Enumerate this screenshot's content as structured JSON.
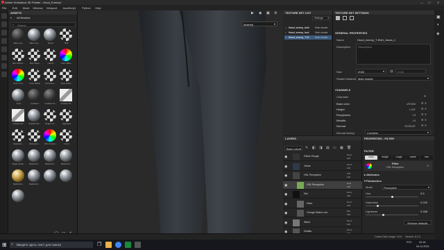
{
  "window": {
    "title": "Adobe Substance 3D Painter - Hood_Enemy1"
  },
  "menu": [
    "File",
    "Edit",
    "Mode",
    "Window",
    "Viewport",
    "JavaScript",
    "Python",
    "Help"
  ],
  "assets": {
    "header": "ASSETS",
    "all_libraries": "All libraries",
    "search_placeholder": "Search",
    "items": [
      {
        "label": "Basic Lig...",
        "style": "dark"
      },
      {
        "label": "Basic Lig...",
        "style": "metal"
      },
      {
        "label": "Bevel",
        "style": "metal"
      },
      {
        "label": "Blur",
        "style": "checker"
      },
      {
        "label": "Blur Directi...",
        "style": "checker"
      },
      {
        "label": "Blur Slope",
        "style": "checker"
      },
      {
        "label": "Clamp",
        "style": "checker"
      },
      {
        "label": "Color Bala...",
        "style": "color"
      },
      {
        "label": "Color Corr...",
        "style": "color"
      },
      {
        "label": "Color Match",
        "style": "checker"
      },
      {
        "label": "Contrast L...",
        "style": "checker"
      },
      {
        "label": "Drop Shad...",
        "style": "checker"
      },
      {
        "label": "Emit",
        "style": "metal"
      },
      {
        "label": "Gradient",
        "style": "dark"
      },
      {
        "label": "Gradient D...",
        "style": "dark"
      },
      {
        "label": "Gradient M...",
        "style": "sheet"
      },
      {
        "label": "Gradient M...",
        "style": "sheet"
      },
      {
        "label": "Gradient M...",
        "style": "metal"
      },
      {
        "label": "Height To ...",
        "style": "checker"
      },
      {
        "label": "Highpass",
        "style": "checker"
      },
      {
        "label": "Highpass ...",
        "style": "checker"
      },
      {
        "label": "Histogram...",
        "style": "checker"
      },
      {
        "label": "HSL Percep...",
        "style": "color"
      },
      {
        "label": "Invert",
        "style": "checker"
      },
      {
        "label": "Magic Scale...",
        "style": "metal"
      },
      {
        "label": "MatFinish ...",
        "style": "metal"
      },
      {
        "label": "MatFinish ...",
        "style": "metal"
      },
      {
        "label": "MatFinish ...",
        "style": "metal"
      },
      {
        "label": "MatFinish ...",
        "style": "gold"
      },
      {
        "label": "MatFinish ...",
        "style": "metal"
      },
      {
        "label": "",
        "style": "metal"
      },
      {
        "label": "",
        "style": "metal"
      },
      {
        "label": "",
        "style": "metal"
      }
    ]
  },
  "viewport": {
    "material_mode": "Material"
  },
  "texture_set_list": {
    "header": "TEXTURE SET LIST",
    "settings_label": "Settings",
    "rows": [
      {
        "name": "Hood_enemy_bott",
        "shader": "Main shader",
        "selected": false
      },
      {
        "name": "Hood_enemy_bod",
        "shader": "Main shader",
        "selected": false
      },
      {
        "name": "Hood_enemy_T-Sl",
        "shader": "Main shader",
        "selected": true
      }
    ]
  },
  "texture_set_settings": {
    "header": "TEXTURE SET SETTINGS",
    "general_header": "GENERAL PROPERTIES",
    "name_label": "Name",
    "name_value": "Hood_enemy_T-Shirt_Jeans_1",
    "description_label": "Description",
    "description_placeholder": "Description",
    "size_label": "Size",
    "size_value": "2048",
    "size_linked": "2048",
    "shader_label": "Shader instance",
    "shader_value": "Main shader",
    "channels_header": "CHANNELS",
    "channels_label": "Channels",
    "channels": [
      {
        "name": "Base color",
        "format": "sRGB8"
      },
      {
        "name": "Height",
        "format": "L16F"
      },
      {
        "name": "Roughness",
        "format": "L8"
      },
      {
        "name": "Metallic",
        "format": "L8"
      },
      {
        "name": "Normal",
        "format": "RGB16F"
      }
    ],
    "normal_mixing_label": "Normal mixing",
    "normal_mixing_value": "Combine"
  },
  "layers": {
    "header": "LAYERS",
    "blend_select": "Base color",
    "items": [
      {
        "name": "Fabric Rough",
        "blend": "Norm",
        "opacity": "100",
        "thumb": "#333",
        "indent": false,
        "selected": false
      },
      {
        "name": "Jeans",
        "blend": "Norm",
        "opacity": "100",
        "thumb": "#2d3a4a",
        "indent": false,
        "selected": false
      },
      {
        "name": "HSL Perceptive",
        "blend": "Pthr",
        "opacity": "100",
        "thumb": "#444",
        "indent": false,
        "selected": false
      },
      {
        "name": "HSL Perceptive",
        "blend": "Repl",
        "opacity": "100",
        "thumb": "#7a5",
        "indent": true,
        "selected": true
      },
      {
        "name": "Dirt",
        "blend": "Norm",
        "opacity": "100",
        "thumb": "#111",
        "indent": false,
        "selected": false
      },
      {
        "name": "Paint",
        "blend": "Norm",
        "opacity": "100",
        "thumb": "#666",
        "indent": true,
        "selected": false
      },
      {
        "name": "Grunge Stains Lea",
        "blend": "Mul",
        "opacity": "100",
        "thumb": "#555",
        "indent": true,
        "selected": false
      },
      {
        "name": "Stitch",
        "blend": "Norm",
        "opacity": "100",
        "thumb": "#777",
        "indent": false,
        "selected": false
      },
      {
        "name": "Details",
        "blend": "Norm",
        "opacity": "100",
        "thumb": "#555",
        "indent": false,
        "selected": false
      }
    ]
  },
  "properties": {
    "header": "PROPERTIES - FILTER",
    "filter_label": "FILTER",
    "channel_buttons": [
      "color",
      "height",
      "rough",
      "metal",
      "nrm"
    ],
    "filter_title": "Filter",
    "filter_name": "HSL Perceptive",
    "attributes_label": "Attributes",
    "parameters_label": "Parameters",
    "mode_label": "Mode",
    "mode_value": "Perceptive",
    "params": [
      {
        "name": "Hue",
        "value": "0.5",
        "fraction": 0.5
      },
      {
        "name": "Saturation",
        "value": "0.225",
        "fraction": 0.225
      },
      {
        "name": "Lightness",
        "value": "0.338",
        "fraction": 0.338
      }
    ],
    "restore_label": "Restore defaults"
  },
  "status": {
    "cache": "Cache Disk Usage:",
    "cache_value": "21%",
    "version": "Version: 8.2.0"
  },
  "taskbar": {
    "search_placeholder": "Введите здесь текст для поиска",
    "time": "22:16",
    "date": "04.11.2021",
    "lang": "РУС"
  },
  "colors": {
    "accent": "#3b5b7f",
    "panel": "#262626",
    "denim": "#2f3338"
  }
}
